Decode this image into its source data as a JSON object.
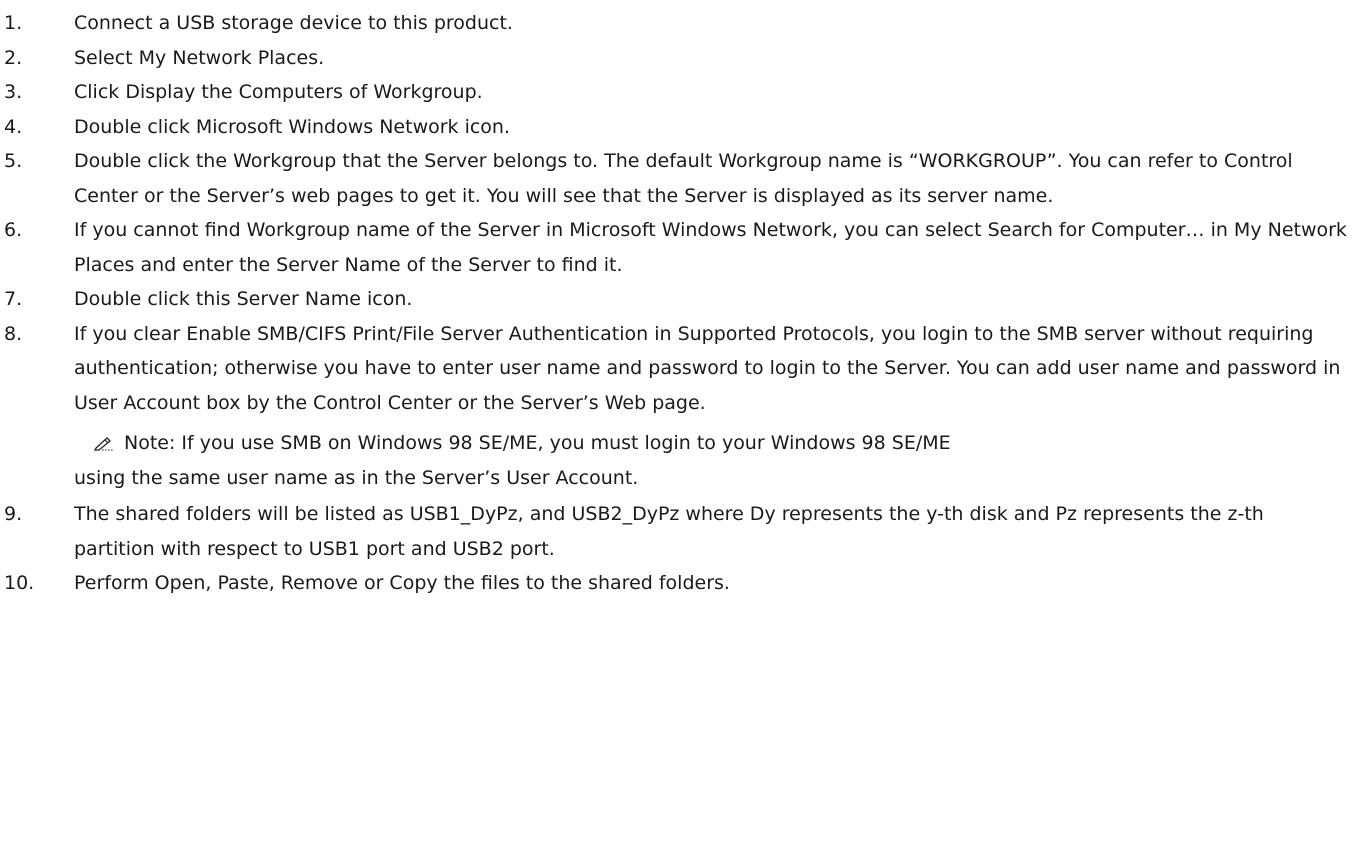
{
  "steps": [
    {
      "num": "1.",
      "text": "Connect a USB storage device to this product."
    },
    {
      "num": "2.",
      "text": "Select My Network Places."
    },
    {
      "num": "3.",
      "text": "Click Display the Computers of Workgroup."
    },
    {
      "num": "4.",
      "text": "Double click Microsoft Windows Network icon."
    },
    {
      "num": "5.",
      "text": "Double click the Workgroup that the Server belongs to. The default Workgroup name is “WORKGROUP”. You can refer to Control Center or the Server’s web pages to get it. You will see that the Server is displayed as its server name."
    },
    {
      "num": "6.",
      "text": "If you cannot find Workgroup name of the Server in Microsoft Windows Network, you can select Search for Computer… in My Network Places and enter the Server Name of the Server to find it."
    },
    {
      "num": "7.",
      "text": "Double click this Server Name icon."
    },
    {
      "num": "8.",
      "text": "If you clear Enable SMB/CIFS Print/File Server Authentication in Supported Protocols, you login to the SMB server without requiring authentication; otherwise you have to enter user name and password to login to the Server. You can add user name and password in User Account box by the Control Center or the Server’s Web page."
    },
    {
      "num": "9.",
      "text": "The shared folders will be listed as USB1_DyPz, and USB2_DyPz where Dy represents the y-th disk and Pz represents the z-th partition with respect to USB1 port and USB2 port."
    },
    {
      "num": "10.",
      "text": "Perform Open, Paste, Remove or Copy the files to the shared folders."
    }
  ],
  "note": {
    "icon": "pencil-note-icon",
    "line1": "Note: If you use SMB on Windows 98 SE/ME, you must login to your Windows 98 SE/ME",
    "line2": "using the same user name as in the Server’s User Account."
  }
}
